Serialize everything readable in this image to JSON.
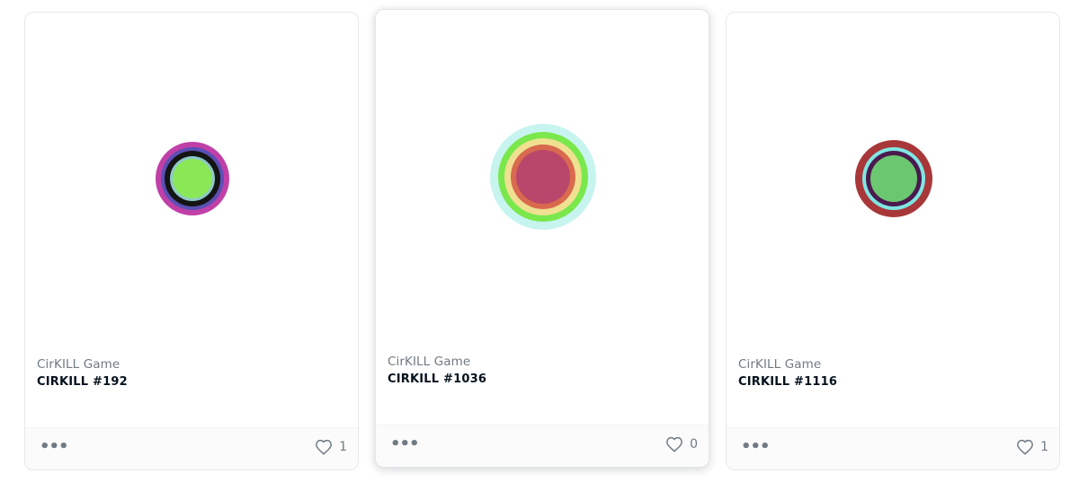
{
  "cards": [
    {
      "collection": "CirKILL Game",
      "name": "CIRKILL #192",
      "likes": "1",
      "rings": [
        "#c040a8",
        "#5b4fb5",
        "#141414",
        "#8fc8c8",
        "#8ae856"
      ]
    },
    {
      "collection": "CirKILL Game",
      "name": "CIRKILL #1036",
      "likes": "0",
      "rings": [
        "#c8f4f0",
        "#7ae84c",
        "#f0e092",
        "#d96a4e",
        "#b9466b"
      ]
    },
    {
      "collection": "CirKILL Game",
      "name": "CIRKILL #1116",
      "likes": "1",
      "rings": [
        "#a8373a",
        "#7fe6e2",
        "#4a1a4e",
        "#6cc870"
      ]
    }
  ],
  "icons": {
    "more": "more-options-icon",
    "heart": "heart-icon"
  }
}
